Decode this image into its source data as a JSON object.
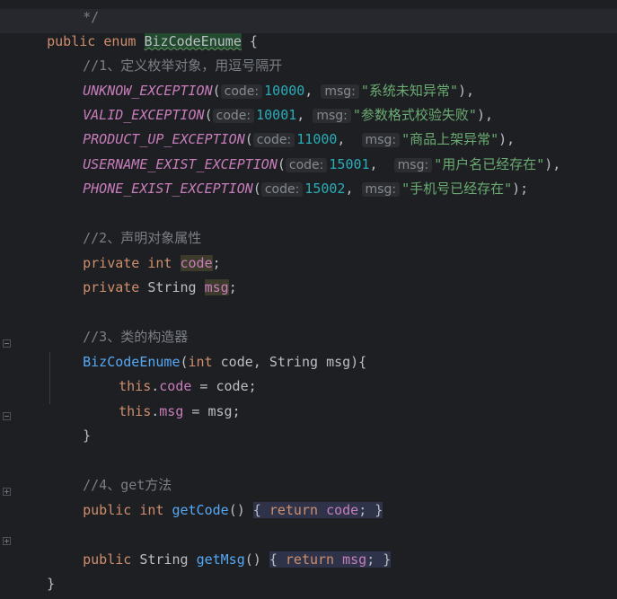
{
  "code": {
    "partial_top": "*/",
    "l1": {
      "kw1": "public",
      "kw2": "enum",
      "name": "BizCodeEnume",
      "brace": "{"
    },
    "c1": "//1、定义枚举对象，用逗号隔开",
    "consts": [
      {
        "name": "UNKNOW_EXCEPTION",
        "code_hint": "code:",
        "code": "10000",
        "msg_hint": "msg:",
        "msg": "\"系统未知异常\"",
        "end": "),"
      },
      {
        "name": "VALID_EXCEPTION",
        "code_hint": "code:",
        "code": "10001",
        "msg_hint": "msg:",
        "msg": "\"参数格式校验失败\"",
        "end": "),"
      },
      {
        "name": "PRODUCT_UP_EXCEPTION",
        "code_hint": "code:",
        "code": "11000",
        "msg_hint": "msg:",
        "msg": "\"商品上架异常\"",
        "end": "),"
      },
      {
        "name": "USERNAME_EXIST_EXCEPTION",
        "code_hint": "code:",
        "code": "15001",
        "msg_hint": "msg:",
        "msg": "\"用户名已经存在\"",
        "end": "),"
      },
      {
        "name": "PHONE_EXIST_EXCEPTION",
        "code_hint": "code:",
        "code": "15002",
        "msg_hint": "msg:",
        "msg": "\"手机号已经存在\"",
        "end": ");"
      }
    ],
    "c2": "//2、声明对象属性",
    "f1": {
      "kw": "private",
      "type": "int",
      "name": "code"
    },
    "f2": {
      "kw": "private",
      "type": "String",
      "name": "msg"
    },
    "c3": "//3、类的构造器",
    "ctor": {
      "name": "BizCodeEnume",
      "type1": "int",
      "p1": "code",
      "type2": "String",
      "p2": "msg"
    },
    "ctor_body1": {
      "this": "this",
      "field": "code",
      "rhs": "code"
    },
    "ctor_body2": {
      "this": "this",
      "field": "msg",
      "rhs": "msg"
    },
    "close_brace": "}",
    "c4": "//4、get方法",
    "g1": {
      "kw": "public",
      "type": "int",
      "name": "getCode",
      "ret": "return",
      "val": "code"
    },
    "g2": {
      "kw": "public",
      "type": "String",
      "name": "getMsg",
      "ret": "return",
      "val": "msg"
    },
    "final_brace": "}"
  },
  "colors": {
    "background": "#1e1f22",
    "keyword": "#cf8e6d",
    "function": "#56a8f5",
    "constant": "#c77dbb",
    "number": "#2aacb8",
    "string": "#6aab73",
    "comment": "#7a7e85"
  }
}
